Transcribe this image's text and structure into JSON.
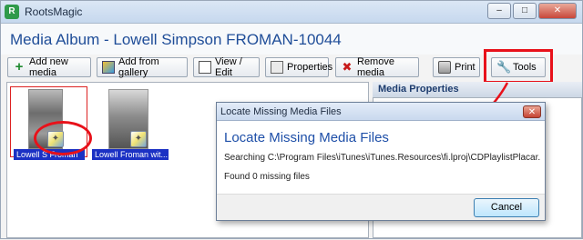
{
  "window": {
    "app_title": "RootsMagic",
    "min_glyph": "–",
    "max_glyph": "□",
    "close_glyph": "✕"
  },
  "header": {
    "album_title": "Media Album - Lowell Simpson FROMAN-10044"
  },
  "toolbar": {
    "add_new_media": "Add new media",
    "add_from_gallery": "Add from gallery",
    "view_edit": "View / Edit",
    "properties": "Properties",
    "remove_media": "Remove media",
    "print": "Print",
    "tools": "Tools"
  },
  "media": {
    "items": [
      {
        "caption": "Lowell S Froman"
      },
      {
        "caption": "Lowell Froman wit..."
      }
    ]
  },
  "properties_panel": {
    "title": "Media Properties"
  },
  "dialog": {
    "title": "Locate Missing Media Files",
    "heading": "Locate Missing Media Files",
    "searching": "Searching C:\\Program Files\\iTunes\\iTunes.Resources\\fi.lproj\\CDPlaylistPlacar...\\",
    "found": "Found 0 missing files",
    "cancel_label": "Cancel",
    "close_glyph": "✕"
  },
  "annotation_color": "#e8111a",
  "icons": [
    "app-icon",
    "plus-icon",
    "gallery-icon",
    "view-icon",
    "properties-icon",
    "remove-icon",
    "printer-icon",
    "wrench-icon",
    "media-missing-badge-icon"
  ]
}
